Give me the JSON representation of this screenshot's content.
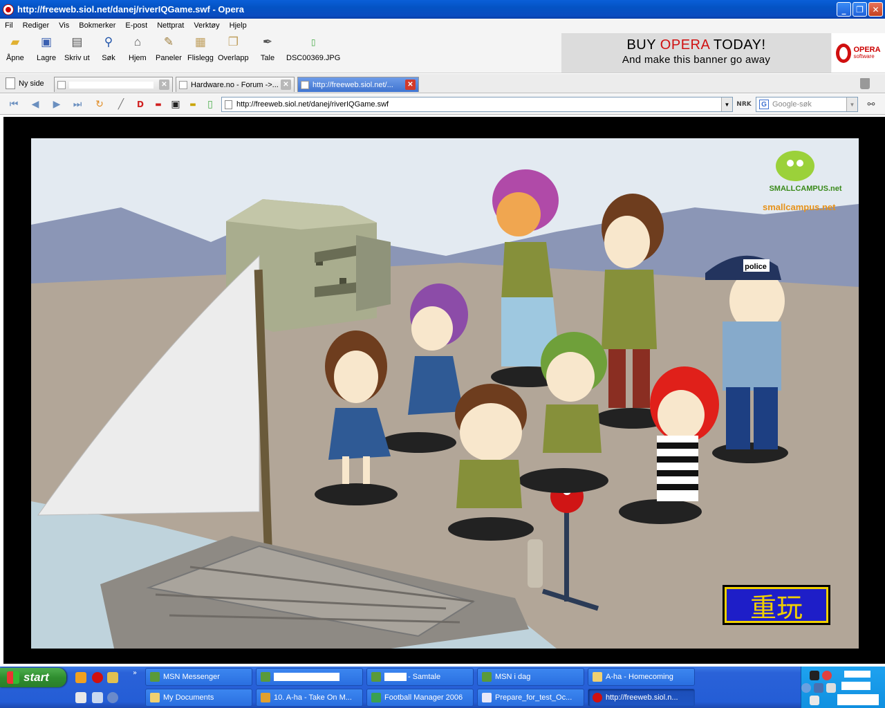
{
  "window": {
    "title": "http://freeweb.siol.net/danej/riverIQGame.swf - Opera",
    "controls": [
      "minimize",
      "maximize",
      "close"
    ]
  },
  "menu": [
    "Fil",
    "Rediger",
    "Vis",
    "Bokmerker",
    "E-post",
    "Nettprat",
    "Verktøy",
    "Hjelp"
  ],
  "toolbar": {
    "buttons": [
      {
        "label": "Åpne",
        "icon": "folder-open-icon"
      },
      {
        "label": "Lagre",
        "icon": "save-disk-icon"
      },
      {
        "label": "Skriv ut",
        "icon": "printer-icon"
      },
      {
        "label": "Søk",
        "icon": "magnifier-icon"
      },
      {
        "label": "Hjem",
        "icon": "home-icon"
      },
      {
        "label": "Paneler",
        "icon": "panels-icon"
      },
      {
        "label": "Flislegg",
        "icon": "tile-icon"
      },
      {
        "label": "Overlapp",
        "icon": "cascade-icon"
      },
      {
        "label": "Tale",
        "icon": "voice-icon"
      },
      {
        "label": "DSC00369.JPG",
        "icon": "image-file-icon"
      }
    ]
  },
  "ad_banner": {
    "line1_pre": "BUY ",
    "line1_brand": "OPERA",
    "line1_post": " TODAY!",
    "line2": "And make this banner go away",
    "logo_text": "OPERA",
    "logo_sub": "software"
  },
  "tabs": {
    "new_page_label": "Ny side",
    "items": [
      {
        "title": "",
        "active": false
      },
      {
        "title": "Hardware.no - Forum ->...",
        "active": false
      },
      {
        "title": "http://freeweb.siol.net/...",
        "active": true
      }
    ]
  },
  "address": {
    "url": "http://freeweb.siol.net/danej/riverIQGame.swf",
    "search_placeholder": "Google-søk",
    "nrk_label": "NRK"
  },
  "game": {
    "brand_text": "smallcampus.net",
    "logo_text": "SMALLCAMPUS.net",
    "police_cap_text": "police",
    "replay_button_label": "重玩",
    "colors": {
      "replay_bg": "#1e1ec8",
      "replay_text": "#f0d000",
      "brand": "#e6921a"
    }
  },
  "taskbar": {
    "start_label": "start",
    "row1": [
      {
        "label": "MSN Messenger",
        "icon": "msn-icon"
      },
      {
        "label": "",
        "icon": "msn-chat-icon"
      },
      {
        "label": "- Samtale",
        "icon": "msn-chat-icon"
      },
      {
        "label": "MSN i dag",
        "icon": "msn-icon"
      },
      {
        "label": "A-ha - Homecoming",
        "icon": "folder-icon"
      }
    ],
    "row2": [
      {
        "label": "My Documents",
        "icon": "folder-icon"
      },
      {
        "label": "10. A-ha - Take On M...",
        "icon": "winamp-icon"
      },
      {
        "label": "Football Manager 2006",
        "icon": "fm-icon"
      },
      {
        "label": "Prepare_for_test_Oc...",
        "icon": "word-icon"
      },
      {
        "label": "http://freeweb.siol.n...",
        "icon": "opera-icon",
        "active": true
      }
    ]
  }
}
